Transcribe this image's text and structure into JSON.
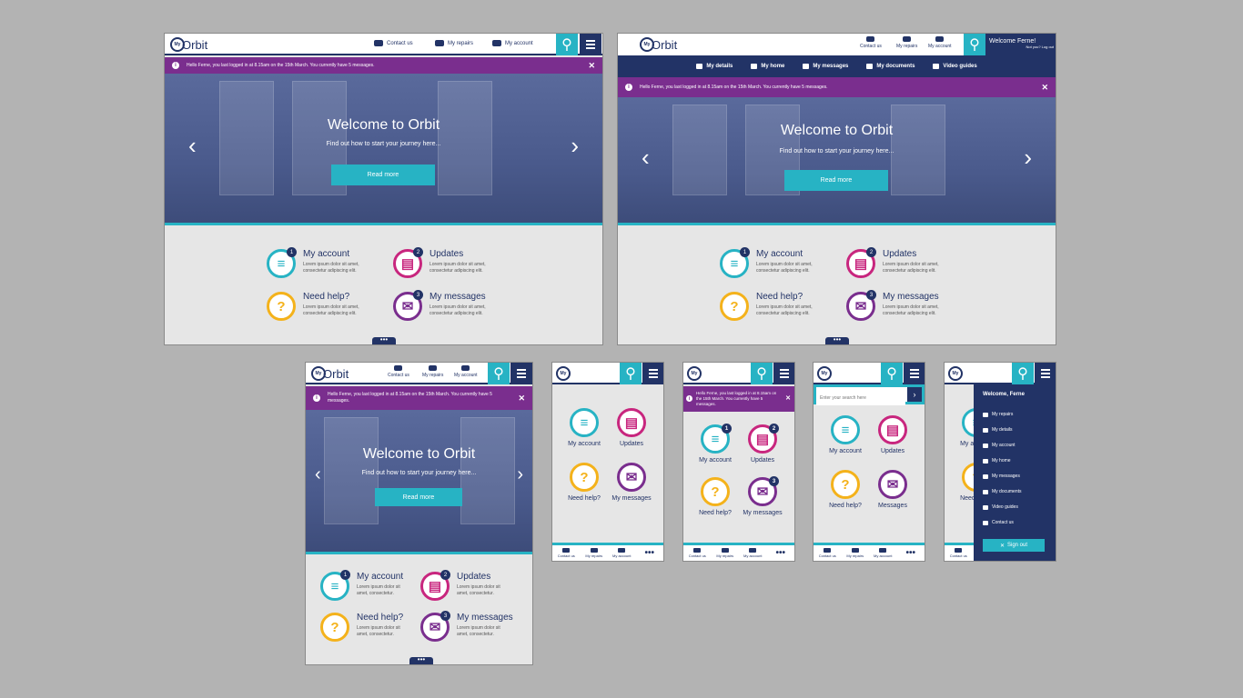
{
  "brand": {
    "my": "My",
    "orbit": "rbit"
  },
  "desktop": {
    "nav": [
      "Contact us",
      "My repairs",
      "My account"
    ],
    "message": "Hello Ferne, you last logged in at 8.15am on the 15th March. You currently have 5 messages.",
    "hero_title": "Welcome to",
    "hero_sub": "Find out how to start your journey here...",
    "read_more": "Read more",
    "welcome_user": "Welcome Ferne!",
    "not_you": "Not you? Log out",
    "subnav": [
      "My details",
      "My home",
      "My messages",
      "My documents",
      "Video guides"
    ]
  },
  "tiles": [
    {
      "name": "My account",
      "desc": "Lorem ipsum dolor sit amet, consectetur adipiscing elit.",
      "desc_short": "Lorem ipsum dolor sit amet, consectetur.",
      "badge": "1",
      "color": "#27b3c4",
      "icon": "account-icon"
    },
    {
      "name": "Updates",
      "desc": "Lorem ipsum dolor sit amet, consectetur adipiscing elit.",
      "desc_short": "Lorem ipsum dolor sit amet, consectetur.",
      "badge": "2",
      "color": "#c8267e",
      "icon": "updates-icon"
    },
    {
      "name": "Need help?",
      "desc": "Lorem ipsum dolor sit amet, consectetur adipiscing elit.",
      "desc_short": "Lorem ipsum dolor sit amet, consectetur.",
      "badge": "",
      "color": "#f4b21b",
      "icon": "help-icon"
    },
    {
      "name": "My messages",
      "desc": "Lorem ipsum dolor sit amet, consectetur adipiscing elit.",
      "desc_short": "Lorem ipsum dolor sit amet, consectetur.",
      "badge": "3",
      "color": "#7a2e8e",
      "icon": "messages-icon"
    }
  ],
  "tablet_message": "Hello Ferne, you last logged in at 8.15am on the 15th March. You currently have 5 messages.",
  "mobile_message": "Hello Ferne, you last logged in at 8.15am on the 15th March. You currently have 5 messages.",
  "mobile_footer": [
    "Contact us",
    "My repairs",
    "My account"
  ],
  "mobile_dots": "•••",
  "search_placeholder": "Enter your search here",
  "messages_short": "Messages",
  "sidebar": {
    "welcome": "Welcome, Ferne",
    "items": [
      "My repairs",
      "My details",
      "My account",
      "My home",
      "My messages",
      "My documents",
      "Video guides",
      "Contact us"
    ],
    "signout": "Sign out"
  }
}
